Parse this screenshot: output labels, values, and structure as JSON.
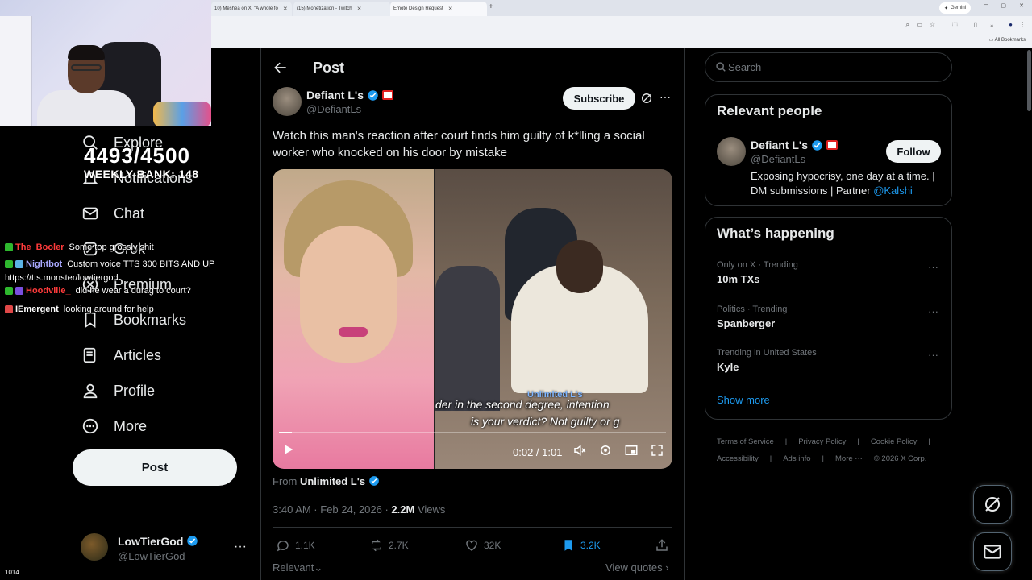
{
  "browser": {
    "tabs": [
      "10) Meshea on X: \"A whole fo",
      "(15) Monetization - Twitch",
      "Emote Design Request"
    ],
    "gemini_label": "Gemini",
    "all_bookmarks": "All Bookmarks"
  },
  "overlay": {
    "goal": "4493/4500",
    "weekly": "WEEKLY BANK: 148",
    "viewers": "1014",
    "chat": [
      {
        "user": "The_Booler",
        "message": "Some top grossly shit",
        "color": "#ff3b3b"
      },
      {
        "user": "Nightbot",
        "message": "Custom voice TTS 300 BITS AND UP",
        "color": "#a9a9ff"
      },
      {
        "user": "",
        "message": "https://tts.monster/lowtiergod",
        "color": "#ffffff"
      },
      {
        "user": "Hoodville_",
        "message": "did he wear a durag to court?",
        "color": "#ff3b3b"
      },
      {
        "user": "IEmergent",
        "message": "looking around for help",
        "color": "#ffffff"
      }
    ]
  },
  "nav": {
    "items": [
      {
        "label": "Explore",
        "icon": "search-icon"
      },
      {
        "label": "Notifications",
        "icon": "bell-icon"
      },
      {
        "label": "Chat",
        "icon": "mail-icon"
      },
      {
        "label": "Grok",
        "icon": "grok-icon"
      },
      {
        "label": "Premium",
        "icon": "x-logo-icon"
      },
      {
        "label": "Bookmarks",
        "icon": "bookmark-icon"
      },
      {
        "label": "Articles",
        "icon": "article-icon"
      },
      {
        "label": "Profile",
        "icon": "person-icon"
      },
      {
        "label": "More",
        "icon": "more-circle-icon"
      }
    ],
    "post_button": "Post",
    "account": {
      "name": "LowTierGod",
      "handle": "@LowTierGod"
    }
  },
  "post": {
    "header": "Post",
    "author_name": "Defiant L's",
    "author_handle": "@DefiantLs",
    "subscribe": "Subscribe",
    "text": "Watch this man's reaction after court finds him guilty of k*lling a social worker who knocked on his door by mistake",
    "video": {
      "caption_line1": "der in the second degree, intention",
      "caption_line2": "is your verdict? Not guilty or g",
      "watermark": "Unlimited L's",
      "time": "0:02 / 1:01",
      "progress": 0.033
    },
    "from_label": "From",
    "from_source": "Unlimited L's",
    "timestamp": "3:40 AM · Feb 24, 2026 · ",
    "views_count": "2.2M",
    "views_label": " Views",
    "stats": {
      "replies": "1.1K",
      "reposts": "2.7K",
      "likes": "32K",
      "bookmarks": "3.2K"
    },
    "relevant": "Relevant",
    "view_quotes": "View quotes"
  },
  "sidebar": {
    "search_placeholder": "Search",
    "relevant_people": {
      "title": "Relevant people",
      "name": "Defiant L's",
      "handle": "@DefiantLs",
      "follow": "Follow",
      "bio": "Exposing hypocrisy, one day at a time. | DM submissions | Partner ",
      "bio_link": "@Kalshi"
    },
    "happening": {
      "title": "What’s happening",
      "trends": [
        {
          "category": "Only on X · Trending",
          "name": "10m TXs"
        },
        {
          "category": "Politics · Trending",
          "name": "Spanberger"
        },
        {
          "category": "Trending in United States",
          "name": "Kyle"
        }
      ],
      "show_more": "Show more"
    },
    "footer": [
      "Terms of Service",
      "|",
      "Privacy Policy",
      "|",
      "Cookie Policy",
      "|",
      "Accessibility",
      "|",
      "Ads info",
      "|",
      "More ···",
      "© 2026 X Corp."
    ]
  },
  "colors": {
    "accent": "#1d9bf0",
    "border": "#2f3336",
    "muted": "#71767b",
    "verified": "#1d9bf0"
  }
}
